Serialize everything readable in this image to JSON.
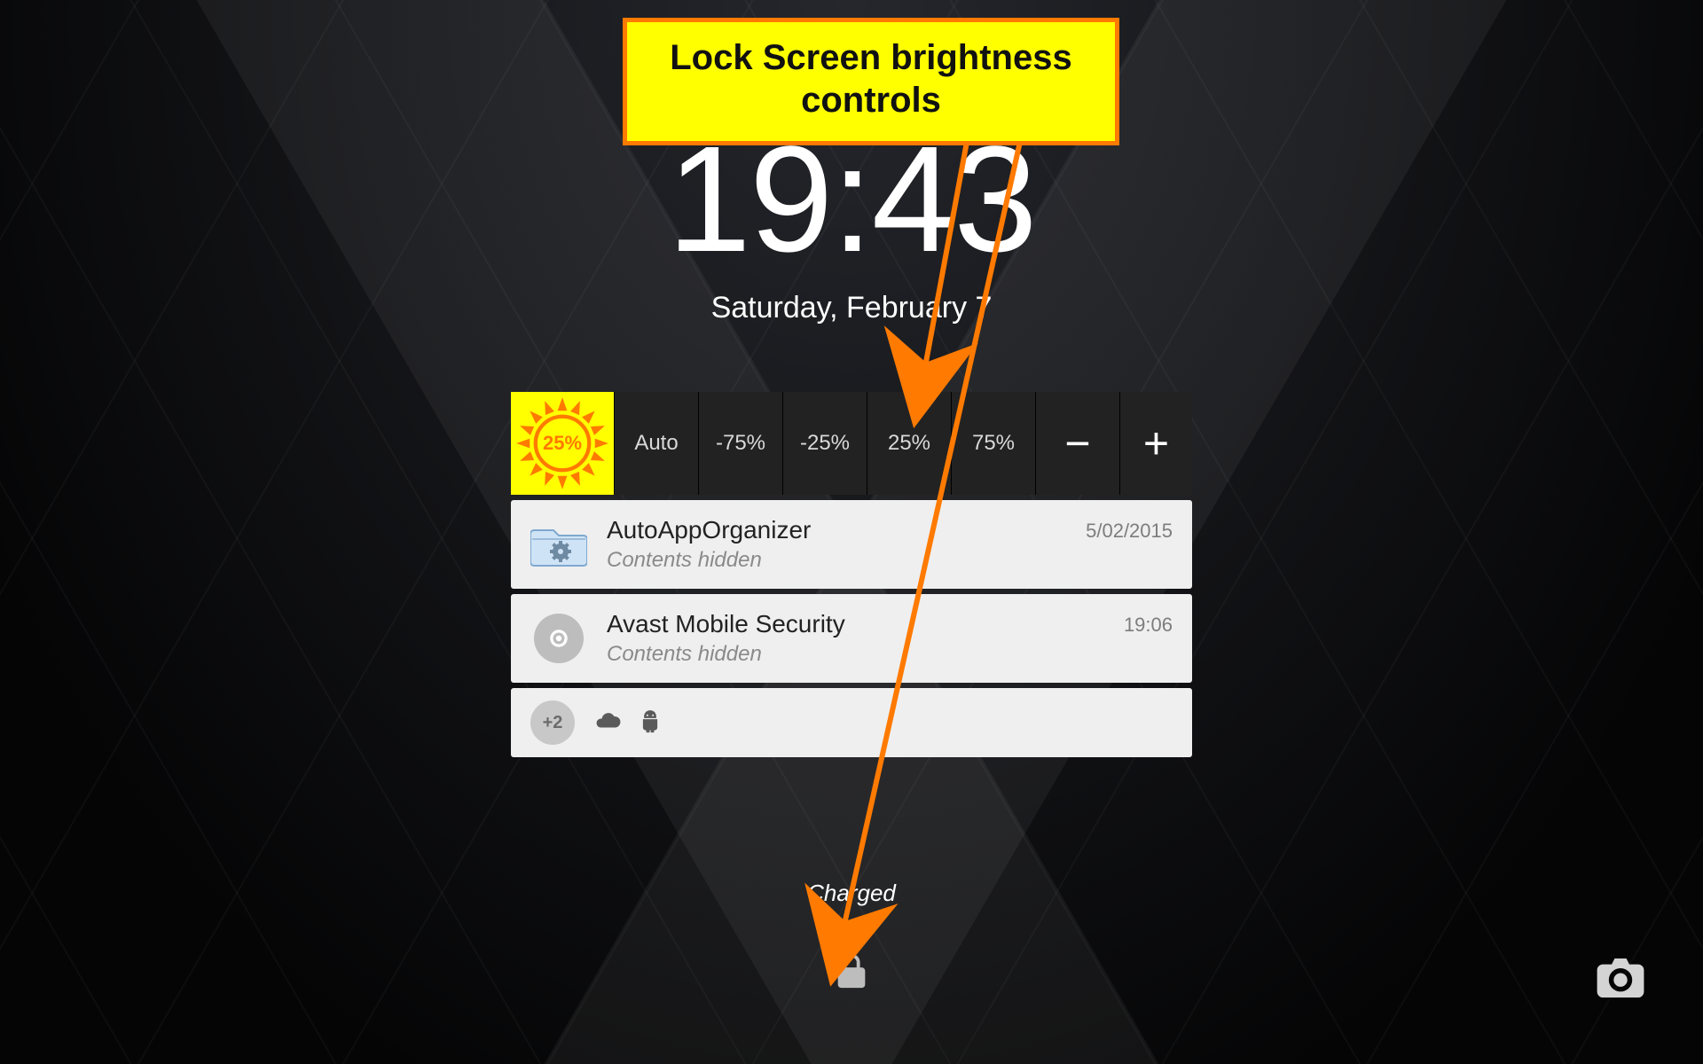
{
  "clock": {
    "time": "19:43",
    "date": "Saturday, February 7"
  },
  "brightness": {
    "current_pct": "25%",
    "auto_label": "Auto",
    "presets": [
      "-75%",
      "-25%",
      "25%",
      "75%"
    ],
    "minus": "−",
    "plus": "+"
  },
  "notifications": [
    {
      "app": "AutoAppOrganizer",
      "subtitle": "Contents hidden",
      "meta": "5/02/2015",
      "icon": "folder-gear"
    },
    {
      "app": "Avast Mobile Security",
      "subtitle": "Contents hidden",
      "meta": "19:06",
      "icon": "avast"
    }
  ],
  "summary": {
    "more_count": "+2"
  },
  "bottom": {
    "charge_text": "Charged"
  },
  "callout": {
    "line1": "Lock Screen brightness",
    "line2": "controls"
  }
}
